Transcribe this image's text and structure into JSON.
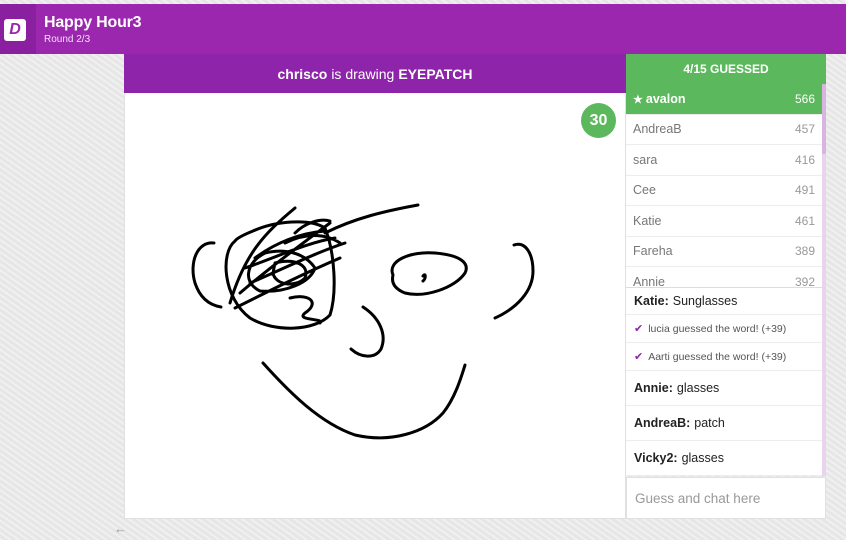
{
  "header": {
    "title": "Happy Hour3",
    "round": "Round 2/3",
    "logo_letter": "D"
  },
  "drawing": {
    "drawer": "chrisco",
    "middle_text": "is drawing",
    "word": "EYEPATCH",
    "timer": "30"
  },
  "guessed": {
    "summary": "4/15 GUESSED"
  },
  "players": [
    {
      "name": "avalon",
      "score": "566",
      "top": true
    },
    {
      "name": "AndreaB",
      "score": "457"
    },
    {
      "name": "sara",
      "score": "416"
    },
    {
      "name": "Cee",
      "score": "491"
    },
    {
      "name": "Katie",
      "score": "461"
    },
    {
      "name": "Fareha",
      "score": "389"
    },
    {
      "name": "Annie",
      "score": "392"
    }
  ],
  "chat": [
    {
      "type": "message",
      "author": "Katie:",
      "text": "Sunglasses"
    },
    {
      "type": "system",
      "text": "lucia guessed the word! (+39)"
    },
    {
      "type": "system",
      "text": "Aarti guessed the word! (+39)"
    },
    {
      "type": "message",
      "author": "Annie:",
      "text": "glasses"
    },
    {
      "type": "message",
      "author": "AndreaB:",
      "text": "patch"
    },
    {
      "type": "message",
      "author": "Vicky2:",
      "text": "glasses"
    }
  ],
  "chat_input": {
    "placeholder": "Guess and chat here"
  },
  "colors": {
    "brand_purple": "#9b27af",
    "accent_green": "#5cb85c"
  },
  "icons": {
    "back": "back-arrow-icon",
    "star": "star-icon",
    "check": "check-icon"
  }
}
